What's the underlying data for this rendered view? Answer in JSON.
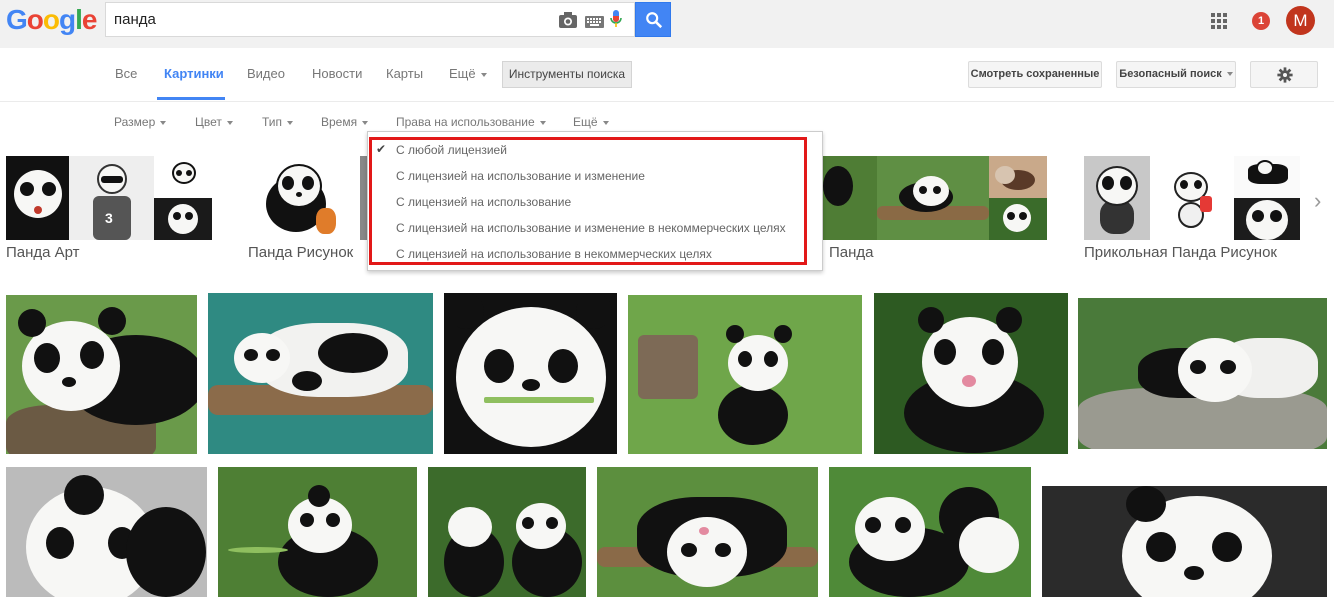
{
  "logo": {
    "letters": [
      "G",
      "o",
      "o",
      "g",
      "l",
      "e"
    ],
    "colors": [
      "#4285f4",
      "#ea4335",
      "#fbbc05",
      "#4285f4",
      "#34a853",
      "#ea4335"
    ]
  },
  "search": {
    "query": "панда"
  },
  "account": {
    "notification_count": "1",
    "avatar_letter": "M"
  },
  "nav": {
    "tabs": [
      "Все",
      "Картинки",
      "Видео",
      "Новости",
      "Карты",
      "Ещё"
    ],
    "active_index": 1,
    "tools_label": "Инструменты поиска",
    "saved_label": "Смотреть сохраненные",
    "safesearch_label": "Безопасный поиск"
  },
  "filters": [
    "Размер",
    "Цвет",
    "Тип",
    "Время",
    "Права на использование",
    "Ещё"
  ],
  "license_dropdown": {
    "items": [
      "С любой лицензией",
      "С лицензией на использование и изменение",
      "С лицензией на использование",
      "С лицензией на использование и изменение в некоммерческих целях",
      "С лицензией на использование в некоммерческих целях"
    ],
    "selected_index": 0,
    "highlight_color": "#e21818"
  },
  "related": [
    {
      "label": "Панда Арт"
    },
    {
      "label": "Панда Рисунок"
    },
    {
      "label": "Панда"
    },
    {
      "label": "Прикольная Панда Рисунок"
    }
  ],
  "colors": {
    "accent": "#4285f4",
    "grass": "#5a8a3a"
  }
}
